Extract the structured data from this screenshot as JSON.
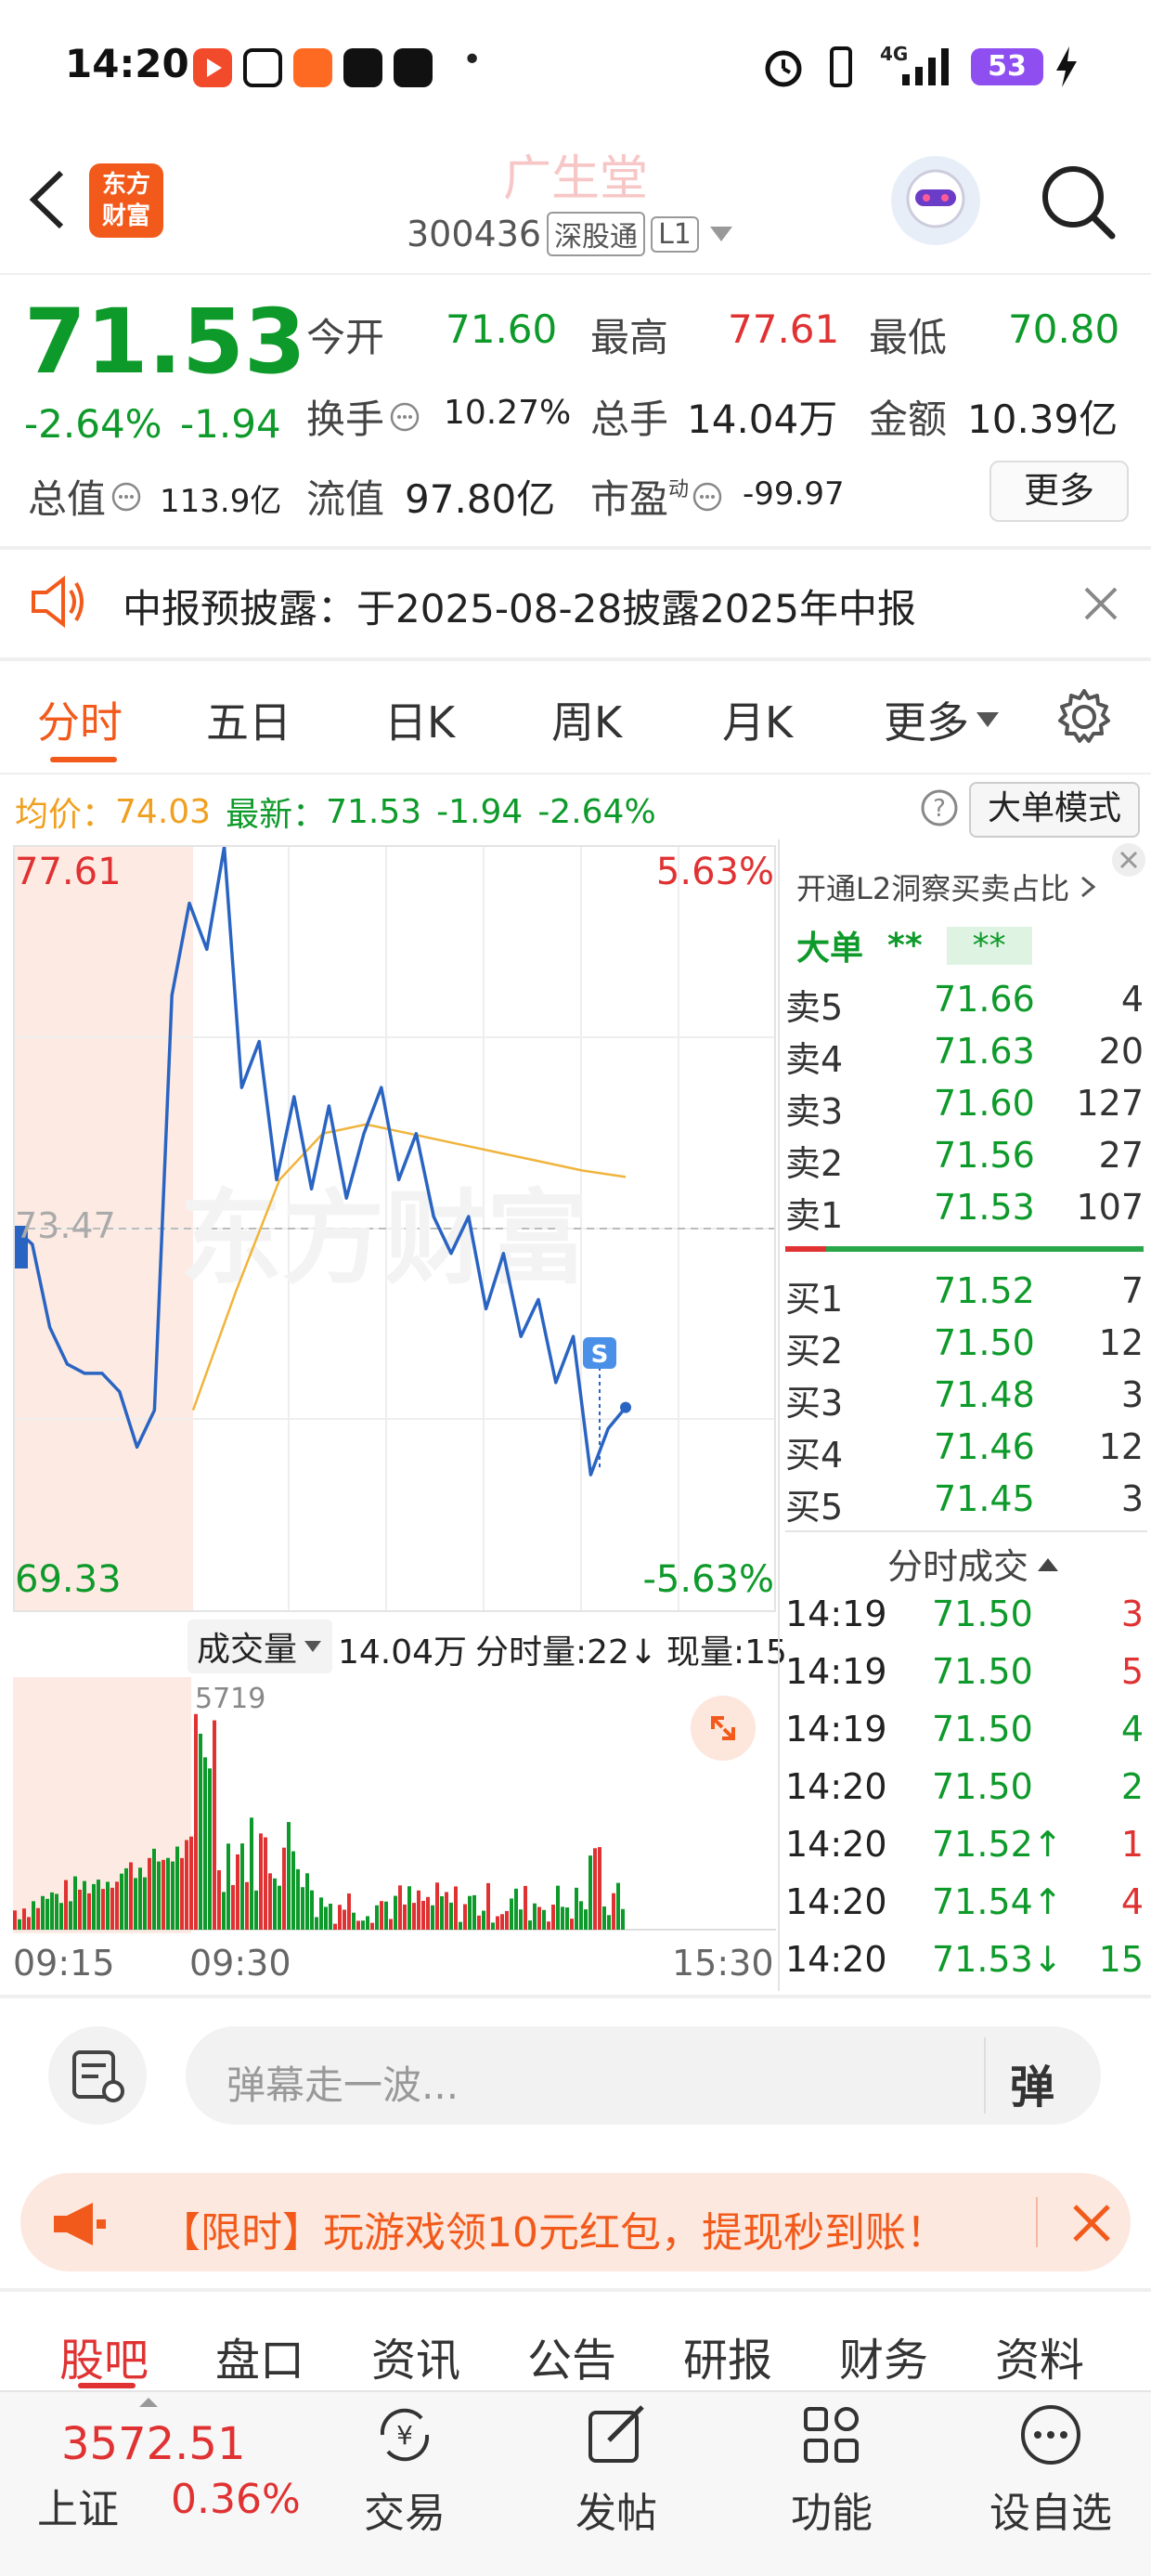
{
  "status_bar": {
    "time": "14:20",
    "network": "4G",
    "battery": "53",
    "more_dot": "•"
  },
  "header": {
    "logo_line1": "东方",
    "logo_line2": "财富",
    "stock_name": "广生堂",
    "stock_code": "300436",
    "badge_connect": "深股通",
    "badge_level": "L1"
  },
  "quote": {
    "price": "71.53",
    "change_pct": "-2.64%",
    "change": "-1.94",
    "open_label": "今开",
    "open": "71.60",
    "high_label": "最高",
    "high": "77.61",
    "low_label": "最低",
    "low": "70.80",
    "turnover_label": "换手",
    "turnover": "10.27%",
    "volume_label": "总手",
    "volume": "14.04万",
    "amount_label": "金额",
    "amount": "10.39亿",
    "mktcap_label": "总值",
    "mktcap": "113.9亿",
    "float_label": "流值",
    "float": "97.80亿",
    "pe_label": "市盈",
    "pe_sup": "动",
    "pe": "-99.97",
    "more_label": "更多"
  },
  "notice": {
    "text": "中报预披露：于2025-08-28披露2025年中报"
  },
  "tabs": [
    "分时",
    "五日",
    "日K",
    "周K",
    "月K",
    "更多"
  ],
  "info_line": {
    "avg_label": "均价：",
    "avg": "74.03",
    "latest_label": "最新：",
    "latest": "71.53",
    "change": "-1.94",
    "change_pct": "-2.64%",
    "big_order_mode": "大单模式"
  },
  "chart_labels": {
    "top_price": "77.61",
    "top_pct": "5.63%",
    "mid_price": "73.47",
    "bottom_price": "69.33",
    "bottom_pct": "-5.63%",
    "sell_marker": "S",
    "watermark": "东方财富",
    "vol_label": "成交量",
    "vol_total": "14.04万",
    "vol_split": "分时量:22↓",
    "vol_now": "现量:15",
    "vol_max": "5719",
    "time_start": "09:15",
    "time_open": "09:30",
    "time_end": "15:30"
  },
  "chart_data": {
    "type": "line",
    "ylim": [
      69.33,
      77.61
    ],
    "prev_close": 73.47,
    "series": [
      {
        "values": [
          73.47,
          73.3,
          72.4,
          72.0,
          71.9,
          71.9,
          71.7,
          71.1,
          71.5,
          76.0,
          77.0,
          76.5,
          77.61,
          75.0,
          75.5,
          74.0,
          74.9,
          73.9,
          74.8,
          73.8,
          74.5,
          75.0,
          74.0,
          74.5,
          73.6,
          73.2,
          73.6,
          72.6,
          73.2,
          72.3,
          72.7,
          71.8,
          72.3,
          70.8,
          71.3,
          71.53
        ]
      },
      {
        "values": [
          71.5,
          72.8,
          74.0,
          74.5,
          74.6,
          74.5,
          74.4,
          74.3,
          74.2,
          74.1,
          74.03
        ]
      }
    ]
  },
  "orderbook": {
    "header": "开通L2洞察买卖占比",
    "big_label": "大单",
    "big_v1": "**",
    "big_v2": "**",
    "asks": [
      {
        "label": "卖5",
        "price": "71.66",
        "vol": "4"
      },
      {
        "label": "卖4",
        "price": "71.63",
        "vol": "20"
      },
      {
        "label": "卖3",
        "price": "71.60",
        "vol": "127"
      },
      {
        "label": "卖2",
        "price": "71.56",
        "vol": "27"
      },
      {
        "label": "卖1",
        "price": "71.53",
        "vol": "107"
      }
    ],
    "bids": [
      {
        "label": "买1",
        "price": "71.52",
        "vol": "7"
      },
      {
        "label": "买2",
        "price": "71.50",
        "vol": "12"
      },
      {
        "label": "买3",
        "price": "71.48",
        "vol": "3"
      },
      {
        "label": "买4",
        "price": "71.46",
        "vol": "12"
      },
      {
        "label": "买5",
        "price": "71.45",
        "vol": "3"
      }
    ],
    "ticks_header": "分时成交",
    "ticks": [
      {
        "time": "14:19",
        "price": "71.50",
        "vol": "3"
      },
      {
        "time": "14:19",
        "price": "71.50",
        "vol": "5"
      },
      {
        "time": "14:19",
        "price": "71.50",
        "vol": "4"
      },
      {
        "time": "14:20",
        "price": "71.50",
        "vol": "2"
      },
      {
        "time": "14:20",
        "price": "71.52↑",
        "vol": "1"
      },
      {
        "time": "14:20",
        "price": "71.54↑",
        "vol": "4"
      },
      {
        "time": "14:20",
        "price": "71.53↓",
        "vol": "15"
      }
    ]
  },
  "danmu": {
    "placeholder": "弹幕走一波...",
    "button": "弹"
  },
  "promo": {
    "text": "【限时】玩游戏领10元红包，提现秒到账！"
  },
  "bottom_tabs": [
    "股吧",
    "盘口",
    "资讯",
    "公告",
    "研报",
    "财务",
    "资料"
  ],
  "bottom_bar": {
    "index_value": "3572.51",
    "index_name": "上证",
    "index_pct": "0.36%",
    "trade": "交易",
    "post": "发帖",
    "functions": "功能",
    "watchlist": "设自选"
  },
  "colors": {
    "brand": "#f25a1b",
    "up": "#e03232",
    "down": "#0e9a2a",
    "price_line": "#2a64c2",
    "avg_line": "#f0b43c"
  }
}
